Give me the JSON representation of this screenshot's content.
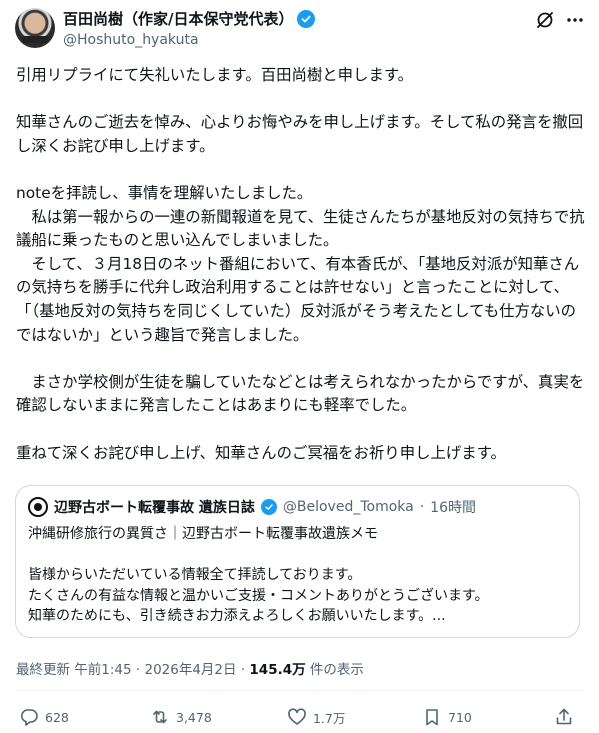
{
  "author": {
    "name": "百田尚樹（作家/日本保守党代表）",
    "handle": "@Hoshuto_hyakuta"
  },
  "post": {
    "text": "引用リプライにて失礼いたします。百田尚樹と申します。\n\n知華さんのご逝去を悼み、心よりお悔やみを申し上げます。そして私の発言を撤回し深くお詫び申し上げます。\n\nnoteを拝読し、事情を理解いたしました。\n　私は第一報からの一連の新聞報道を見て、生徒さんたちが基地反対の気持ちで抗議船に乗ったものと思い込んでしまいました。\n　そして、３月18日のネット番組において、有本香氏が、「基地反対派が知華さんの気持ちを勝手に代弁し政治利用することは許せない」と言ったことに対して、「（基地反対の気持ちを同じくしていた）反対派がそう考えたとしても仕方ないのではないか」という趣旨で発言しました。\n\n　まさか学校側が生徒を騙していたなどとは考えられなかったからですが、真実を確認しないままに発言したことはあまりにも軽率でした。\n\n重ねて深くお詫び申し上げ、知華さんのご冥福をお祈り申し上げます。"
  },
  "quoted": {
    "name": "辺野古ボート転覆事故 遺族日誌",
    "handle": "@Beloved_Tomoka",
    "separator": "·",
    "time": "16時間",
    "text": "沖縄研修旅行の異質さ｜辺野古ボート転覆事故遺族メモ\n\n皆様からいただいている情報全て拝読しております。\nたくさんの有益な情報と温かいご支援・コメントありがとうございます。\n知華のためにも、引き続きお力添えよろしくお願いいたします。..."
  },
  "meta": {
    "updated": "最終更新 午前1:45 · 2026年4月2日 ·",
    "views_count": "145.4万",
    "views_label": "件の表示"
  },
  "actions": {
    "replies": "628",
    "reposts": "3,478",
    "likes": "1.7万",
    "bookmarks": "710"
  },
  "colors": {
    "accent": "#1d9bf0",
    "secondary_text": "#536471"
  },
  "icons": [
    "verified-badge-icon",
    "grok-icon",
    "more-icon",
    "reply-icon",
    "repost-icon",
    "like-icon",
    "bookmark-icon",
    "share-icon"
  ]
}
